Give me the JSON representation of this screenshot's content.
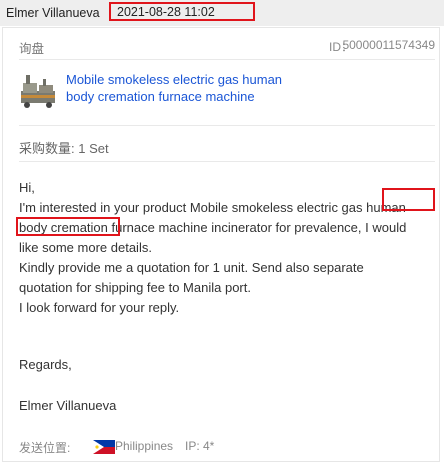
{
  "header": {
    "sender_name": "Elmer Villanueva",
    "timestamp": "2021-08-28 11:02"
  },
  "inquiry": {
    "subject": "询盘",
    "id_label": "ID：",
    "id_value": "50000011574349"
  },
  "product": {
    "image_icon": "machine-thumbnail",
    "title_line1": "Mobile smokeless electric gas human",
    "title_line2": "body cremation furnace machine"
  },
  "quantity": {
    "text": "采购数量: 1 Set"
  },
  "message": {
    "lines": [
      "Hi,",
      "I'm interested in your product Mobile smokeless electric gas human",
      "body cremation furnace machine incinerator for prevalence, I would",
      "like some more details.",
      "Kindly provide me a quotation for 1 unit. Send also separate",
      "quotation for shipping fee to Manila port.",
      "I look forward for your reply."
    ],
    "closing": "Regards,",
    "signature": "Elmer Villanueva"
  },
  "location": {
    "label": "发送位置:",
    "country": "Philippines",
    "flag_icon": "philippines-flag",
    "ip_text": "IP: 4*"
  },
  "colors": {
    "highlight": "#e0141b",
    "link": "#1b56d6",
    "header_bg": "#eeeeee"
  }
}
